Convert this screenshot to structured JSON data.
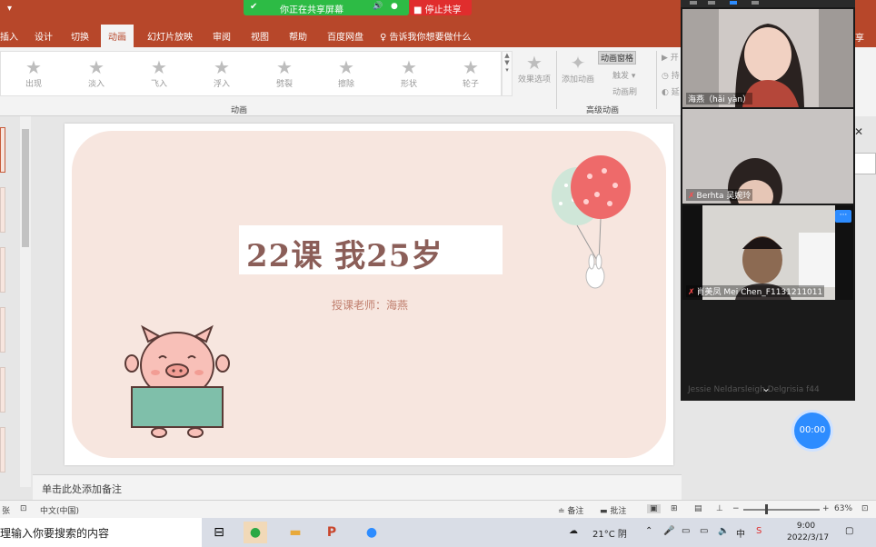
{
  "colors": {
    "ppt_red": "#b7472a",
    "share_green": "#2dbb45",
    "stop_red": "#e02d2d",
    "zoom_blue": "#2d8cff",
    "slide_bg": "#f7e6df",
    "title_color": "#8b5e58"
  },
  "quick_access": "▾",
  "share_bar": {
    "label": "你正在共享屏幕",
    "stop_label": "■ 停止共享"
  },
  "tabs": [
    "插入",
    "设计",
    "切换",
    "动画",
    "幻灯片放映",
    "审阅",
    "视图",
    "帮助",
    "百度网盘"
  ],
  "active_tab": "动画",
  "tell_me": "告诉我你想要做什么",
  "share_tab_right": "享",
  "ribbon": {
    "animations": [
      "出现",
      "淡入",
      "飞入",
      "浮入",
      "劈裂",
      "擦除",
      "形状",
      "轮子"
    ],
    "effect_options": "效果选项",
    "add_animation": "添加动画",
    "animation_pane": "动画窗格",
    "trigger": "触发 ▾",
    "animation_painter": "动画刷",
    "group_animation": "动画",
    "group_advanced": "高级动画",
    "right_clipped": [
      "开",
      "持",
      "延"
    ]
  },
  "slide": {
    "title": "22课 我25岁",
    "teacher": "授课老师：海燕"
  },
  "notes_placeholder": "单击此处添加备注",
  "status": {
    "slide_count": "张",
    "language": "中文(中国)",
    "notes_btn": "备注",
    "comments_btn": "批注",
    "zoom": "63%"
  },
  "zoom_panel": {
    "participants": [
      {
        "name": "海燕（hǎi yàn）",
        "muted": false
      },
      {
        "name": "Berhta 吴婉玲",
        "muted": true
      },
      {
        "name": "肖美凤 Mei Chen_F1131211011",
        "muted": true
      }
    ],
    "more_label": "···",
    "bottom_name": "Jessie Neldarsleigh Delgrisia f44"
  },
  "timer": "00:00",
  "taskbar": {
    "search_placeholder": "理输入你要搜索的内容",
    "weather": "21°C 阴",
    "ime": "中",
    "time": "9:00",
    "date": "2022/3/17"
  }
}
